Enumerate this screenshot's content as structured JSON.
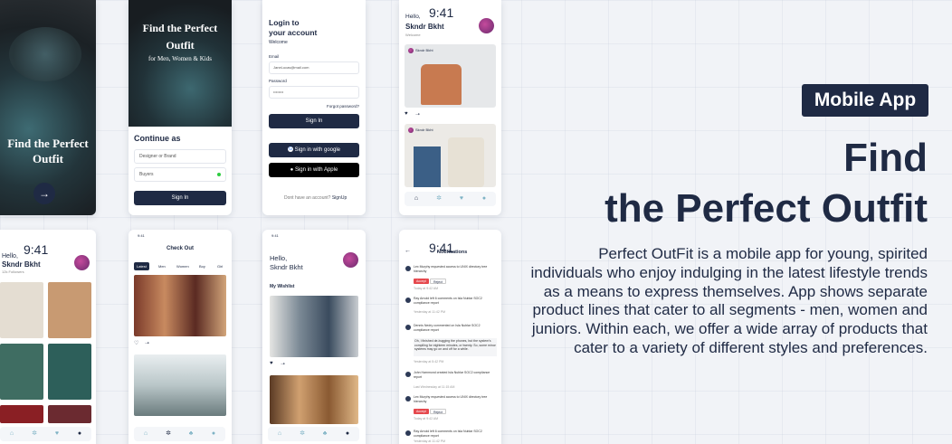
{
  "hero": {
    "badge": "Mobile App",
    "title_line1": "Find",
    "title_line2": "the Perfect Outfit",
    "description": "Perfect OutFit is a mobile app for young, spirited individuals who enjoy indulging in the latest lifestyle trends as a means to express themselves. App shows separate product lines that cater to all segments - men, women and juniors. Within each, we offer a wide array of products that cater to a variety of different styles and preferences."
  },
  "splash": {
    "title_line1": "Find the Perfect",
    "title_line2": "Outfit",
    "arrow": "→"
  },
  "onboarding": {
    "title_line1": "Find the Perfect",
    "title_line2": "Outfit",
    "subtitle": "for Men, Women & Kids",
    "continue_as": "Continue as",
    "option1": "Designer or Brand",
    "option2": "Buyers",
    "sign_in": "Sign In"
  },
  "login": {
    "title_line1": "Login to",
    "title_line2": "your account",
    "welcome": "Welcome",
    "email_label": "Email",
    "email_value": "JaneLucas@mail.com",
    "password_label": "Password",
    "password_value": "••••••••",
    "forgot": "Forgot password?",
    "sign_in": "Sign In",
    "google": "Sign in with google",
    "apple": "Sign in with Apple",
    "no_account": "Dont have an account?",
    "signup": "SignUp"
  },
  "feed": {
    "time": "9:41",
    "hello": "Hello,",
    "name": "Skndr Bkht",
    "welcome": "Welcome",
    "user1": "Skndr Bkht",
    "user2": "Skndr Bkht"
  },
  "profile": {
    "time": "9:41",
    "hello": "Hello,",
    "name": "Skndr Bkht",
    "followers": "12k Followers"
  },
  "checkout": {
    "time": "9:41",
    "title": "Check Out",
    "tabs": [
      "Latest",
      "Men",
      "Women",
      "Boy",
      "Girl"
    ]
  },
  "wishlist": {
    "time": "9:41",
    "hello": "Hello,",
    "name": "Skndr Bkht",
    "section": "My Wishlist"
  },
  "notifications": {
    "time": "9:41",
    "title": "Notifications",
    "items": [
      {
        "text": "Lex Murphy requested access to UNIX directory tree hierarchy",
        "time": "Today at 9:42 AM",
        "actions": [
          "Accept",
          "Reject"
        ]
      },
      {
        "text": "Ray Arnold left 6 comments on Isla Nublar SOC2 compliance report",
        "time": "Yesterday at 11:42 PM"
      },
      {
        "text": "Dennis Nedry commented on Isla Nublar SOC2 compliance report",
        "time": "Yesterday at 5:42 PM",
        "quote": "Oh, I finished de-bugging the phones, but the system's compiling for eighteen minutes, or twenty. So, some minor systems may go on and off for a while."
      },
      {
        "text": "John Hammond created Isla Nublar SOC2 compliance report",
        "time": "Last Wednesday at 11:15 AM"
      },
      {
        "text": "Lex Murphy requested access to UNIX directory tree hierarchy",
        "time": "Today at 9:42 AM",
        "actions": [
          "Accept",
          "Reject"
        ]
      },
      {
        "text": "Ray Arnold left 6 comments on Isla Nublar SOC2 compliance report",
        "time": "Yesterday at 11:42 PM"
      }
    ]
  },
  "colors": {
    "navy": "#1f2a44",
    "accent": "#7fb3c5",
    "background": "#f1f3f7",
    "danger": "#e5484d"
  }
}
